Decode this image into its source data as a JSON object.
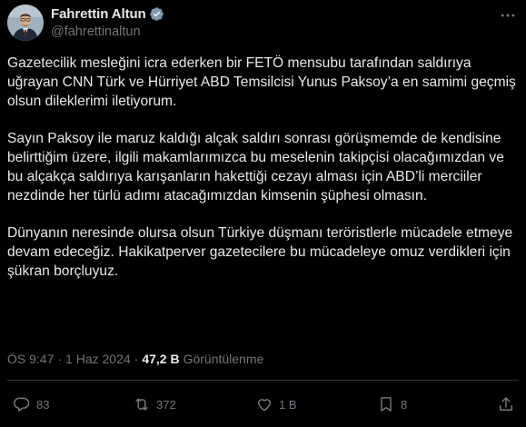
{
  "user": {
    "display_name": "Fahrettin Altun",
    "handle": "@fahrettinaltun",
    "verified": true,
    "avatar_icon": "profile-photo"
  },
  "tweet": {
    "paragraphs": [
      "Gazetecilik mesleğini icra ederken bir FETÖ mensubu tarafından saldırıya uğrayan CNN Türk ve Hürriyet ABD Temsilcisi Yunus Paksoy’a en samimi geçmiş olsun dileklerimi iletiyorum.",
      "Sayın Paksoy ile maruz kaldığı alçak saldırı sonrası görüşmemde de kendisine belirttiğim üzere, ilgili makamlarımızca bu meselenin takipçisi olacağımızdan ve bu alçakça saldırıya karışanların hakettiği cezayı alması için ABD’li merciiler nezdinde her türlü adımı atacağımızdan kimsenin şüphesi olmasın.",
      "Dünyanın neresinde olursa olsun Türkiye düşmanı teröristlerle mücadele etmeye devam edeceğiz. Hakikatperver gazetecilere bu mücadeleye omuz verdikleri için şükran borçluyuz."
    ]
  },
  "meta": {
    "time": "ÖS 9:47",
    "separator": "·",
    "date": "1 Haz 2024",
    "views_count": "47,2 B",
    "views_label": "Görüntülenme"
  },
  "actions": {
    "replies": "83",
    "reposts": "372",
    "likes": "1 B",
    "bookmarks": "8"
  },
  "colors": {
    "background": "#000000",
    "text": "#e7e9ea",
    "secondary": "#71767b",
    "verified": "#829aab",
    "divider": "#2f3336"
  }
}
